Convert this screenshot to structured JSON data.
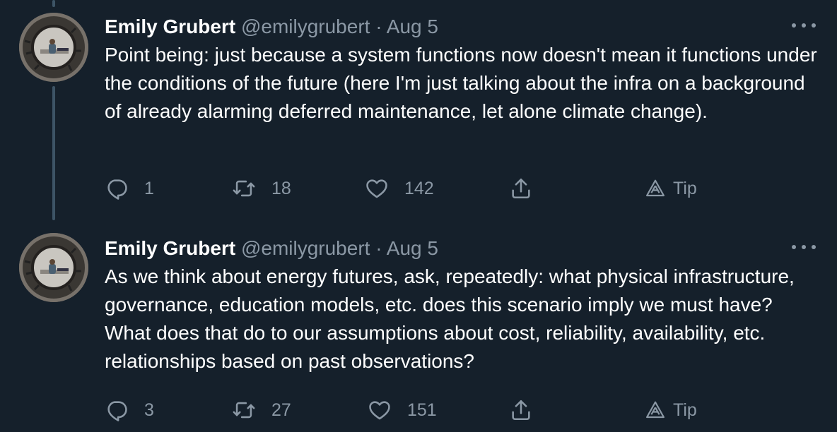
{
  "tweets": [
    {
      "author": {
        "name": "Emily Grubert",
        "handle": "@emilygrubert"
      },
      "separator": "·",
      "date": "Aug 5",
      "text": "Point being: just because a system functions now doesn't mean it functions under the conditions of the future (here I'm just talking about the infra on a background of already alarming deferred maintenance, let alone climate change).",
      "stats": {
        "replies": "1",
        "retweets": "18",
        "likes": "142"
      },
      "tip_label": "Tip"
    },
    {
      "author": {
        "name": "Emily Grubert",
        "handle": "@emilygrubert"
      },
      "separator": "·",
      "date": "Aug 5",
      "text": "As we think about energy futures, ask, repeatedly: what physical infrastructure, governance, education models, etc. does this scenario imply we must have? What does that do to our assumptions about cost, reliability, availability, etc. relationships based on past observations?",
      "stats": {
        "replies": "3",
        "retweets": "27",
        "likes": "151"
      },
      "tip_label": "Tip"
    }
  ],
  "icons": {
    "reply": "reply-icon",
    "retweet": "retweet-icon",
    "like": "heart-icon",
    "share": "share-icon",
    "tip": "tip-icon",
    "more": "more-icon"
  },
  "colors": {
    "background": "#15202b",
    "text_primary": "#ffffff",
    "text_secondary": "#8b98a5",
    "thread_line": "#3d5466"
  }
}
